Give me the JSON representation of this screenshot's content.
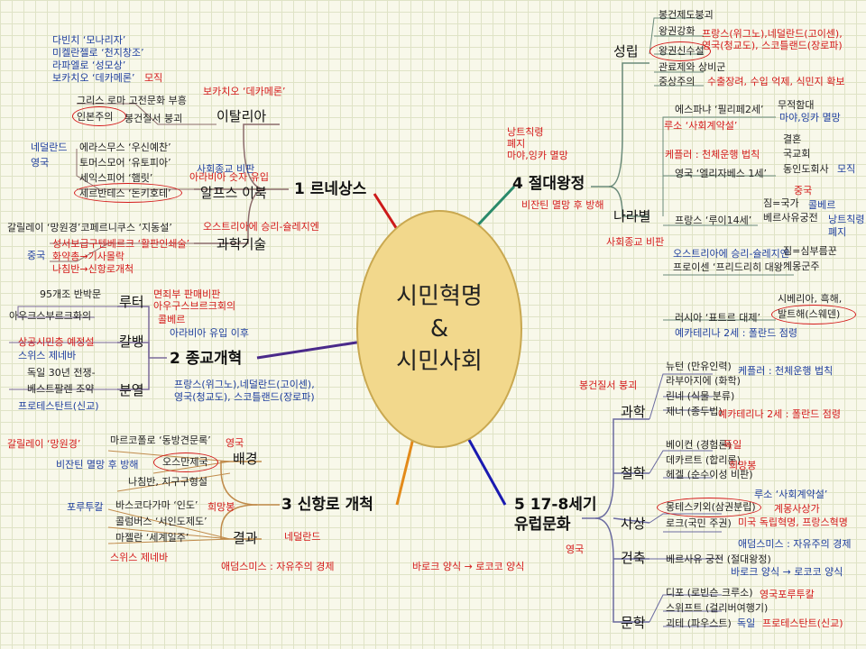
{
  "center": {
    "line1": "시민혁명",
    "line2": "&",
    "line3": "시민사회"
  },
  "branches": {
    "b1": "1 르네상스",
    "b2": "2 종교개혁",
    "b3": "3 신항로 개척",
    "b4": "4 절대왕정",
    "b5_line1": "5 17-8세기",
    "b5_line2": "유럽문화"
  },
  "renaissance": {
    "italy": "이탈리아",
    "alps": "알프스 이북",
    "science": "과학기술",
    "davinci": "다빈치 ‘모나리자’",
    "michelangelo": "미켈란젤로 ‘천지창조’",
    "raphael": "라파엘로 ‘성모상’",
    "boccaccio1": "보카치오 ‘데카메론’",
    "notes1": "모직",
    "boccaccio2": "보카치오 ‘데카메론’",
    "greco": "그리스 로마 고전문화 부흥",
    "humanism": "인본주의",
    "feudal": "봉건질서 붕괴",
    "erasmus": "에라스무스 ‘우신예찬’",
    "more": "토머스모어 ‘유토피아’",
    "shakespeare": "세익스피어 ‘햄릿’",
    "cervantes": "세르반테스 ‘돈키호테’",
    "netherlands": "네덜란드",
    "england": "영국",
    "social_critique": "사회종교 비판",
    "arabic": "아라비아 숫자 유입",
    "galileo": "갈릴레이 ‘망원경’코페르니쿠스 ‘지동설’",
    "austria": "오스트리아에 승리-슐레지엔",
    "gutenberg": "성서보급구텐베르크 ‘활판인쇄술’",
    "china": "중국",
    "gunpowder": "화약총→기사몰락",
    "compass": "나침반→신항로개척"
  },
  "reformation": {
    "luther": "루터",
    "calvin": "칼뱅",
    "division": "분열",
    "theses": "95개조 반박문",
    "augsburg": "아우크스부르크화의",
    "indulgence": "면죄부 판매비판",
    "augsburg_red": "아우구스브르크회의",
    "colbert": "콜베르",
    "arabic_inflow": "아라비아 유입 이후",
    "predestination": "상공시민층 예정설",
    "swiss": "스위스 제네바",
    "thirty_years": "독일 30년 전쟁-",
    "westphalia": "베스트팔렌 조약",
    "protestant": "프로테스탄트(신교)",
    "france": "프랑스(위그노),네덜란드(고이센),",
    "england": "영국(청교도), 스코틀랜드(장로파)"
  },
  "exploration": {
    "background": "배경",
    "result": "결과",
    "galileo": "갈릴레이 ‘망원경’",
    "marco": "마르코폴로 ‘동방견문록’",
    "england": "영국",
    "byzantine": "비잔틴 멸망 후 방해",
    "ottoman": "오스만제국",
    "compass": "나침반, 지구구형설",
    "portugal": "포루투칼",
    "gama": "바스코다가마 ‘인도’",
    "hope": "희망봉",
    "columbus": "콜럼버스 ‘서인도제도’",
    "magellan": "마젤란 ‘세계일주’",
    "netherlands": "네덜란드",
    "swiss": "스위스 제네바",
    "smith": "애덤스미스 : 자유주의 경제",
    "baroque": "바로크 양식 → 로코코 양식"
  },
  "absolutism": {
    "byzantine": "비잔틴 멸망 후 방해",
    "near_red1": "낭트칙령",
    "near_red2": "폐지",
    "maya": "마야,잉카 멸망",
    "establish": "성립",
    "by_nation": "나라별",
    "social_critique": "사회종교 비판",
    "feudal_collapse": "봉건제도붕괴",
    "royal_power": "왕권강화",
    "divine_right": "왕권신수설",
    "bureaucracy": "관료제와 상비군",
    "mercantilism": "중상주의",
    "france_red": "프랑스(위그노),네덜란드(고이센),",
    "england_red": "영국(청교도), 스코틀랜드(장로파)",
    "export": "수출장려, 수입 억제, 식민지 확보",
    "spain": "에스파냐 ‘필리페2세’",
    "invincible": "무적함대",
    "maya_blue": "마야,잉카 멸망",
    "rousseau": "루소 ‘사회계약설’",
    "kepler": "케플러 : 천체운행 법칙",
    "marriage": "결혼",
    "parliament": "국교회",
    "india_co": "동인도회사",
    "wool": "모직",
    "elizabeth": "영국 ‘엘리자베스 1세’",
    "china": "중국",
    "state": "짐=국가",
    "veil": "콜베르",
    "versailles": "베르사유궁전",
    "nantes_b": "낭트칙령",
    "repeal": "폐지",
    "louis": "프랑스 ‘루이14세’",
    "austria": "오스트리아에 승리-슐레지엔",
    "servant": "짐=심부름꾼",
    "enlightened": "계몽군주",
    "prussia": "프로이센 ‘프리드리히 대왕’",
    "siberia": "시베리아, 흑해,",
    "baltic": "발트해(스웨덴)",
    "russia": "러시아 ‘표트르 대제’",
    "catherine": "예카테리나 2세 : 폴란드 점령"
  },
  "culture": {
    "science": "과학",
    "philosophy": "철학",
    "thought": "사상",
    "architecture": "건축",
    "literature": "문학",
    "feudal": "봉건질서 붕괴",
    "newton": "뉴턴 (만유인력)",
    "lavoisier": "라부아지에 (화학)",
    "linne": "린네 (식물 분류)",
    "jenner": "제너 (종두법)",
    "kepler": "케플러 : 천체운행 법칙",
    "catherine": "예카테리나 2세 : 폴란드 점령",
    "bacon": "베이컨 (경험론)",
    "germany": "독일",
    "descartes": "데카르트 (합리론)",
    "hope": "희망봉",
    "hegel": "헤겔 (순수이성 비판)",
    "rousseau": "루소 ‘사회계약설’",
    "montesquieu": "몽테스키외(삼권분립)",
    "enlighten": "계몽사상가",
    "locke": "로크(국민 주권)",
    "revolution": "미국 독립혁명, 프랑스혁명",
    "england": "영국",
    "smith": "애덤스미스 : 자유주의 경제",
    "versailles": "베르사유 궁전 (절대왕정)",
    "baroque": "바로크 양식 → 로코코 양식",
    "defoe": "디포 (로빈슨 크루소)",
    "defoe_red": "영국포루투칼",
    "swift": "스위프트 (걸리버여행기)",
    "goethe": "괴테 (파우스트)",
    "goethe_b": "독일",
    "protestant": "프로테스탄트(신교)"
  },
  "colors": {
    "red": "#d41a1a",
    "blue": "#1f3f9e",
    "center": "#f2d88c"
  }
}
